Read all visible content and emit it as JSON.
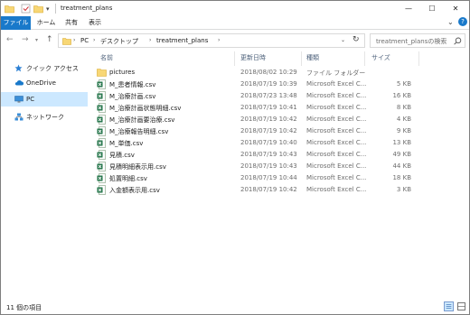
{
  "window": {
    "title": "treatment_plans"
  },
  "ribbon": {
    "tabs": [
      "ファイル",
      "ホーム",
      "共有",
      "表示"
    ]
  },
  "address": {
    "crumbs": [
      "PC",
      "デスクトップ",
      "treatment_plans"
    ]
  },
  "search": {
    "placeholder": "treatment_plansの検索"
  },
  "nav_pane": {
    "items": [
      {
        "label": "クイック アクセス",
        "icon": "star-icon"
      },
      {
        "label": "OneDrive",
        "icon": "cloud-icon"
      },
      {
        "label": "PC",
        "icon": "computer-icon",
        "selected": true
      },
      {
        "label": "ネットワーク",
        "icon": "network-icon"
      }
    ]
  },
  "columns": {
    "name": "名前",
    "date": "更新日時",
    "type": "種類",
    "size": "サイズ"
  },
  "files": [
    {
      "name": "pictures",
      "date": "2018/08/02 10:29",
      "type": "ファイル フォルダー",
      "size": "",
      "icon": "folder-icon"
    },
    {
      "name": "M_患者情報.csv",
      "date": "2018/07/19 10:39",
      "type": "Microsoft Excel C...",
      "size": "5 KB",
      "icon": "excel-csv-icon"
    },
    {
      "name": "M_治療計画.csv",
      "date": "2018/07/23 13:48",
      "type": "Microsoft Excel C...",
      "size": "16 KB",
      "icon": "excel-csv-icon"
    },
    {
      "name": "M_治療計画状態明細.csv",
      "date": "2018/07/19 10:41",
      "type": "Microsoft Excel C...",
      "size": "8 KB",
      "icon": "excel-csv-icon"
    },
    {
      "name": "M_治療計画要治療.csv",
      "date": "2018/07/19 10:42",
      "type": "Microsoft Excel C...",
      "size": "4 KB",
      "icon": "excel-csv-icon"
    },
    {
      "name": "M_治療報告明細.csv",
      "date": "2018/07/19 10:42",
      "type": "Microsoft Excel C...",
      "size": "9 KB",
      "icon": "excel-csv-icon"
    },
    {
      "name": "M_単価.csv",
      "date": "2018/07/19 10:40",
      "type": "Microsoft Excel C...",
      "size": "13 KB",
      "icon": "excel-csv-icon"
    },
    {
      "name": "見積.csv",
      "date": "2018/07/19 10:43",
      "type": "Microsoft Excel C...",
      "size": "49 KB",
      "icon": "excel-csv-icon"
    },
    {
      "name": "見積明細表示用.csv",
      "date": "2018/07/19 10:43",
      "type": "Microsoft Excel C...",
      "size": "44 KB",
      "icon": "excel-csv-icon"
    },
    {
      "name": "処置明細.csv",
      "date": "2018/07/19 10:44",
      "type": "Microsoft Excel C...",
      "size": "18 KB",
      "icon": "excel-csv-icon"
    },
    {
      "name": "入金額表示用.csv",
      "date": "2018/07/19 10:42",
      "type": "Microsoft Excel C...",
      "size": "3 KB",
      "icon": "excel-csv-icon"
    }
  ],
  "status": {
    "count_text": "11 個の項目"
  },
  "colors": {
    "accent": "#1979ca",
    "selection": "#cce8ff",
    "excel_green": "#1e7145",
    "folder_yellow": "#f8d775"
  }
}
